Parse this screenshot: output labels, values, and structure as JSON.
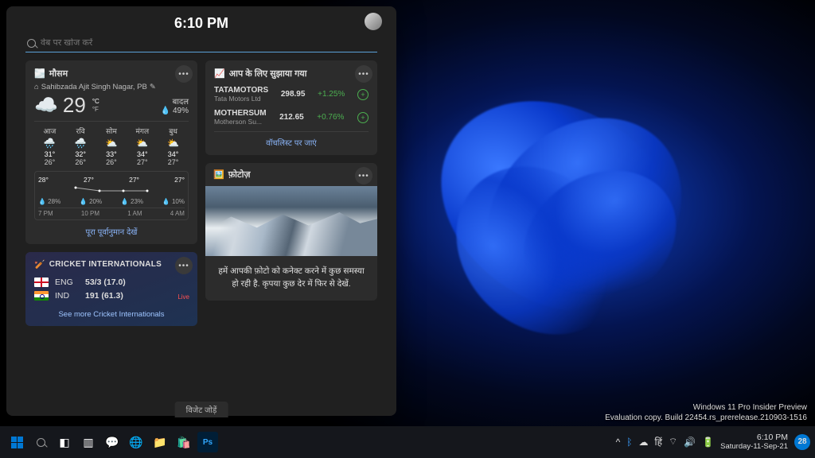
{
  "panel": {
    "time": "6:10 PM",
    "search_placeholder": "वेब पर खोज करें"
  },
  "weather": {
    "title": "मौसम",
    "location": "Sahibzada Ajit Singh Nagar, PB",
    "temp": "29",
    "unit_c": "°C",
    "unit_f": "°F",
    "cond": "बादल",
    "humidity": "49%",
    "days": [
      {
        "label": "आज",
        "icon": "🌧️",
        "hi": "31°",
        "lo": "26°"
      },
      {
        "label": "रवि",
        "icon": "🌧️",
        "hi": "32°",
        "lo": "26°"
      },
      {
        "label": "सोम",
        "icon": "⛅",
        "hi": "33°",
        "lo": "26°"
      },
      {
        "label": "मंगल",
        "icon": "⛅",
        "hi": "34°",
        "lo": "27°"
      },
      {
        "label": "बुध",
        "icon": "⛅",
        "hi": "34°",
        "lo": "27°"
      }
    ],
    "hourly": {
      "temps": [
        "28°",
        "27°",
        "27°",
        "27°"
      ],
      "rain": [
        "28%",
        "20%",
        "23%",
        "10%"
      ],
      "labels": [
        "7 PM",
        "10 PM",
        "1 AM",
        "4 AM"
      ]
    },
    "full_link": "पूरा पूर्वानुमान देखें"
  },
  "cricket": {
    "title": "CRICKET INTERNATIONALS",
    "live": "Live",
    "teams": [
      {
        "flag": "eng",
        "code": "ENG",
        "score": "53/3 (17.0)"
      },
      {
        "flag": "ind",
        "code": "IND",
        "score": "191 (61.3)"
      }
    ],
    "link": "See more Cricket Internationals"
  },
  "stocks": {
    "title": "आप के लिए सुझाया गया",
    "rows": [
      {
        "sym": "TATAMOTORS",
        "sub": "Tata Motors Ltd",
        "price": "298.95",
        "chg": "+1.25%"
      },
      {
        "sym": "MOTHERSUM",
        "sub": "Motherson Su...",
        "price": "212.65",
        "chg": "+0.76%"
      }
    ],
    "link": "वॉचलिस्ट पर जाएं"
  },
  "photos": {
    "title": "फ़ोटोज़",
    "msg": "हमें आपकी फ़ोटो को कनेक्ट करने में कुछ समस्या हो रही है. कृपया कुछ देर में फिर से देखें."
  },
  "add_widget": "विजेट जोड़ें",
  "build": {
    "l1": "Windows 11 Pro Insider Preview",
    "l2": "Evaluation copy. Build 22454.rs_prerelease.210903-1516"
  },
  "taskbar": {
    "lang": "हिं",
    "time": "6:10 PM",
    "date": "Saturday-11-Sep-21",
    "count": "28"
  }
}
